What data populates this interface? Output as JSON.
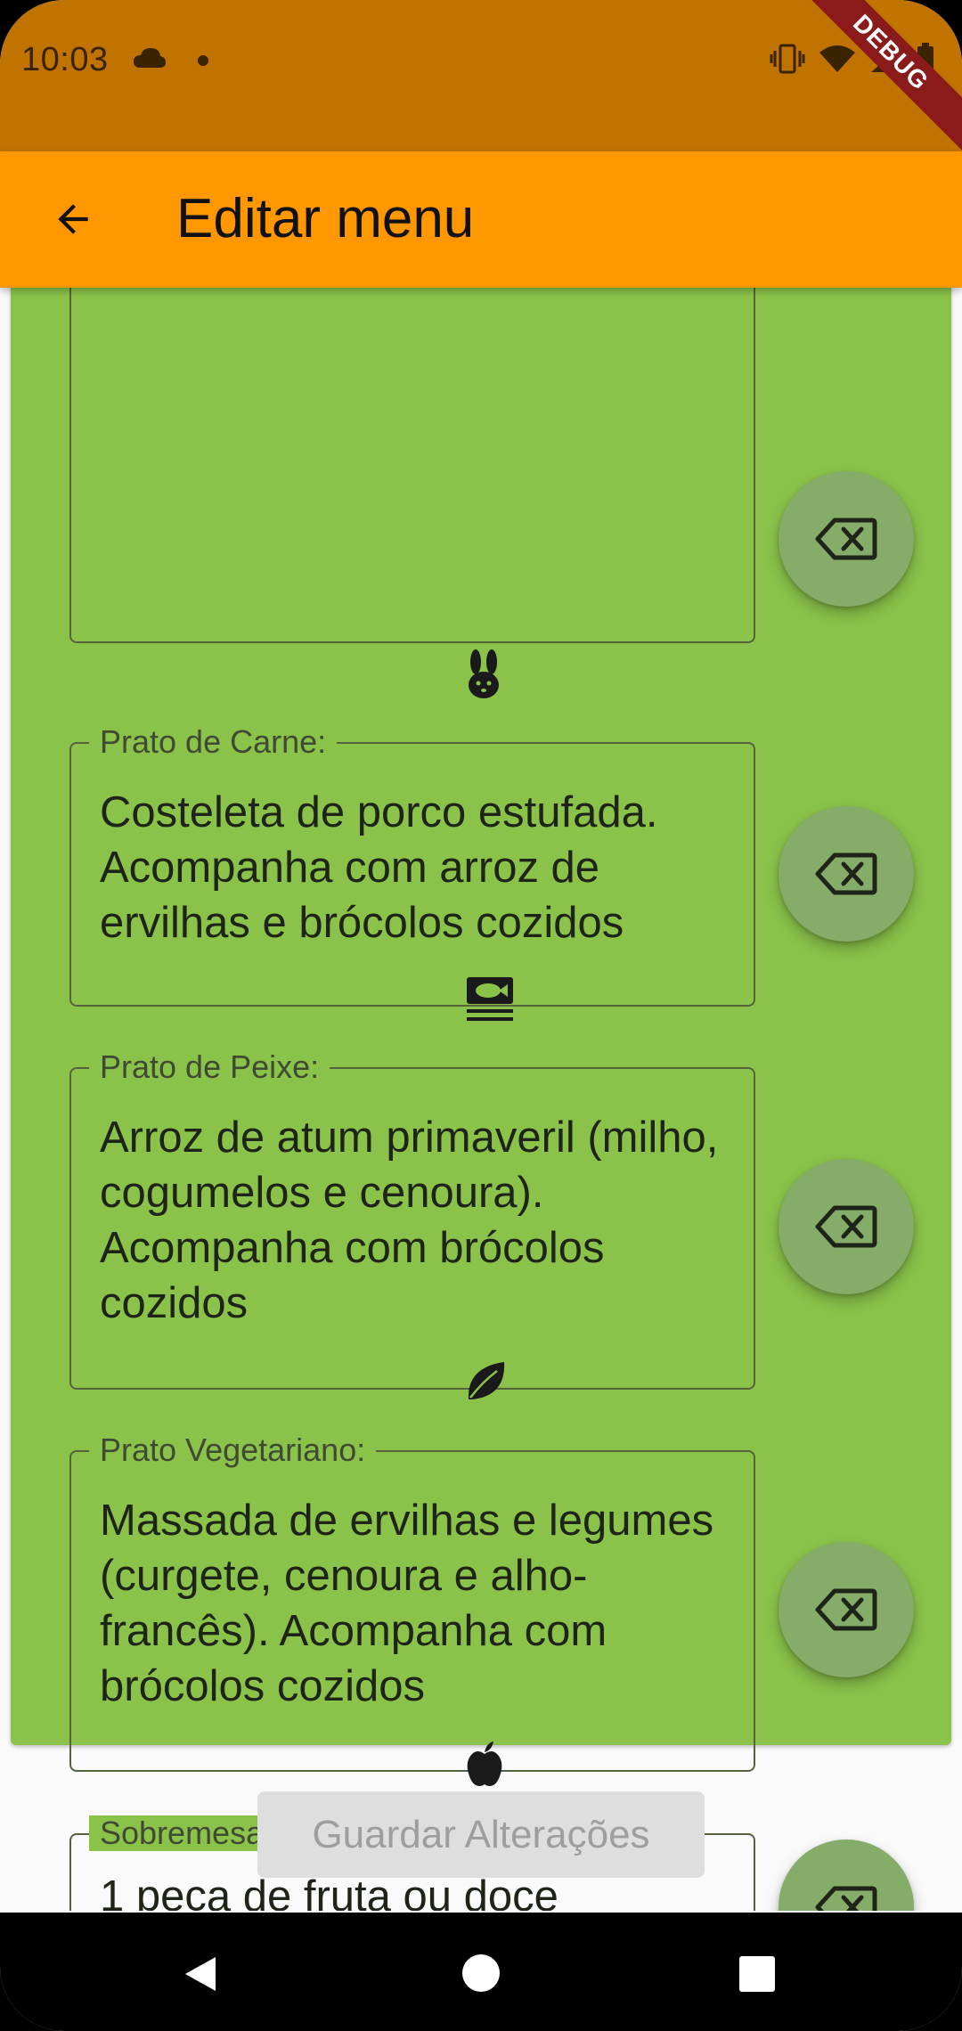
{
  "status_bar": {
    "time": "10:03",
    "debug_label": "DEBUG"
  },
  "app_bar": {
    "title": "Editar menu"
  },
  "fields": [
    {
      "label": "Prato de Carne:",
      "icon": "rabbit-icon",
      "value": "Costeleta de porco estufada. Acompanha com arroz de ervilhas e brócolos cozidos"
    },
    {
      "label": "Prato de Peixe:",
      "icon": "fish-icon",
      "value": "Arroz de atum primaveril (milho, cogumelos e cenoura). Acompanha com brócolos cozidos"
    },
    {
      "label": "Prato Vegetariano:",
      "icon": "leaf-icon",
      "value": "Massada de ervilhas e legumes (curgete, cenoura e alho-francês). Acompanha com brócolos cozidos"
    },
    {
      "label": "Sobremesa:",
      "icon": "apple-icon",
      "value": "1 peça de fruta ou doce"
    }
  ],
  "save_button": {
    "label": "Guardar Alterações",
    "enabled": false
  },
  "colors": {
    "status_bar": "#C17300",
    "app_bar": "#FF9800",
    "card": "#8BC34A",
    "delete_button": "#86AC6A"
  }
}
